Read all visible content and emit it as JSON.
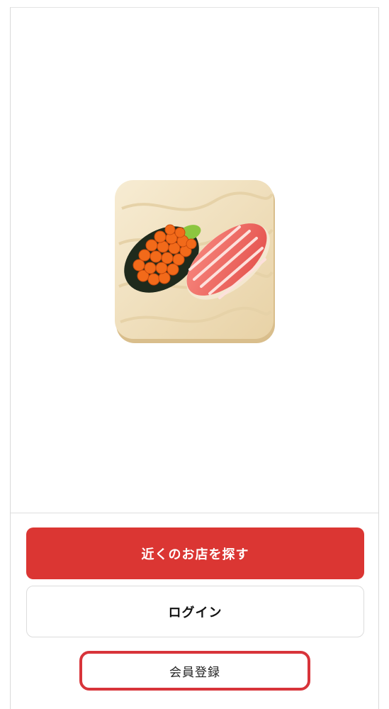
{
  "hero": {
    "illustration": "sushi-plate-illustration",
    "colors": {
      "plate": "#f3e5c8",
      "salmon_roe": "#f26a1a",
      "tuna": "#f0605a",
      "seaweed": "#1f2a1c",
      "cucumber": "#8cc63f"
    }
  },
  "actions": {
    "find_nearby_label": "近くのお店を探す",
    "login_label": "ログイン",
    "register_label": "会員登録"
  },
  "colors": {
    "primary": "#db3633",
    "highlight_outline": "#d8343a"
  }
}
